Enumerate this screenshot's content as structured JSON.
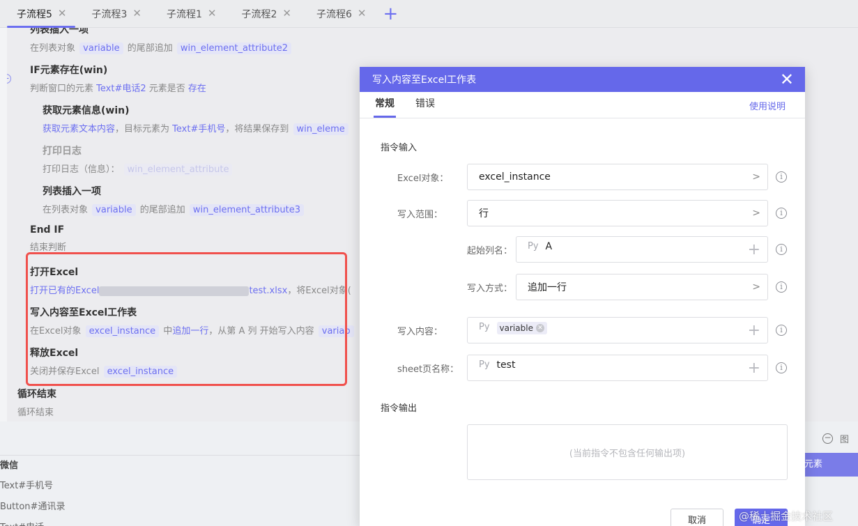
{
  "tabs": [
    {
      "label": "子流程5",
      "active": true
    },
    {
      "label": "子流程3",
      "active": false
    },
    {
      "label": "子流程1",
      "active": false
    },
    {
      "label": "子流程2",
      "active": false
    },
    {
      "label": "子流程6",
      "active": false
    }
  ],
  "tab_add_icon": "plus-icon",
  "flow": {
    "s1": {
      "title": "列表插入一项",
      "d1": "在列表对象",
      "t1": "variable",
      "d2": "的尾部追加",
      "t2": "win_element_attribute2"
    },
    "s2": {
      "title": "IF元素存在(win)",
      "d1": "判断窗口的元素",
      "h1": "Text#电话2",
      "d2": "元素是否",
      "h2": "存在"
    },
    "s3": {
      "title": "获取元素信息(win)",
      "h1": "获取元素文本内容",
      "d1": "，目标元素为",
      "h2": "Text#手机号",
      "d2": "，将结果保存到",
      "t1": "win_eleme"
    },
    "s4": {
      "title": "打印日志",
      "d1": "打印日志（信息）：",
      "t1": "win_element_attribute"
    },
    "s5": {
      "title": "列表插入一项",
      "d1": "在列表对象",
      "t1": "variable",
      "d2": "的尾部追加",
      "t2": "win_element_attribute3"
    },
    "s6": {
      "title": "End IF",
      "d1": "结束判断"
    },
    "s7": {
      "title": "打开Excel",
      "h1": "打开已有的Excel",
      "h2": "test.xlsx",
      "d1": "，将Excel对象("
    },
    "s8": {
      "title": "写入内容至Excel工作表",
      "d1": "在Excel对象",
      "t1": "excel_instance",
      "d2": "中",
      "h1": "追加一行",
      "d3": "，从第 A 列 开始写入内容",
      "t2": "variab"
    },
    "s9": {
      "title": "释放Excel",
      "d1": "关闭并保存Excel",
      "t1": "excel_instance"
    },
    "s10": {
      "title": "循环结束",
      "d1": "循环结束"
    }
  },
  "bottom_panel": {
    "collapse_icon": "minus-circle-icon",
    "label_right": "图",
    "button_label": "元素",
    "items": [
      "微信",
      "Text#手机号",
      "Button#通讯录",
      "Text#电话"
    ]
  },
  "modal": {
    "title": "写入内容至Excel工作表",
    "close_icon": "close-icon",
    "tabs": [
      {
        "label": "常规",
        "active": true
      },
      {
        "label": "错误",
        "active": false
      }
    ],
    "help_link": "使用说明",
    "input_section": "指令输入",
    "fields": {
      "excel_object": {
        "label": "Excel对象：",
        "value": "excel_instance"
      },
      "write_range": {
        "label": "写入范围：",
        "value": "行"
      },
      "start_column": {
        "label": "起始列名：",
        "prefix": "Py",
        "value": "A"
      },
      "write_mode": {
        "label": "写入方式：",
        "value": "追加一行"
      },
      "content": {
        "label": "写入内容：",
        "prefix": "Py",
        "chip": "variable"
      },
      "sheet_name": {
        "label": "sheet页名称：",
        "prefix": "Py",
        "value": "test"
      }
    },
    "output_section": "指令输出",
    "output_placeholder": "(当前指令不包含任何输出项)",
    "cancel_label": "取消",
    "ok_label": "确定"
  },
  "watermark": "@稀土掘金技术社区",
  "colors": {
    "accent": "#6568ea",
    "highlight_box": "#f0504c"
  }
}
